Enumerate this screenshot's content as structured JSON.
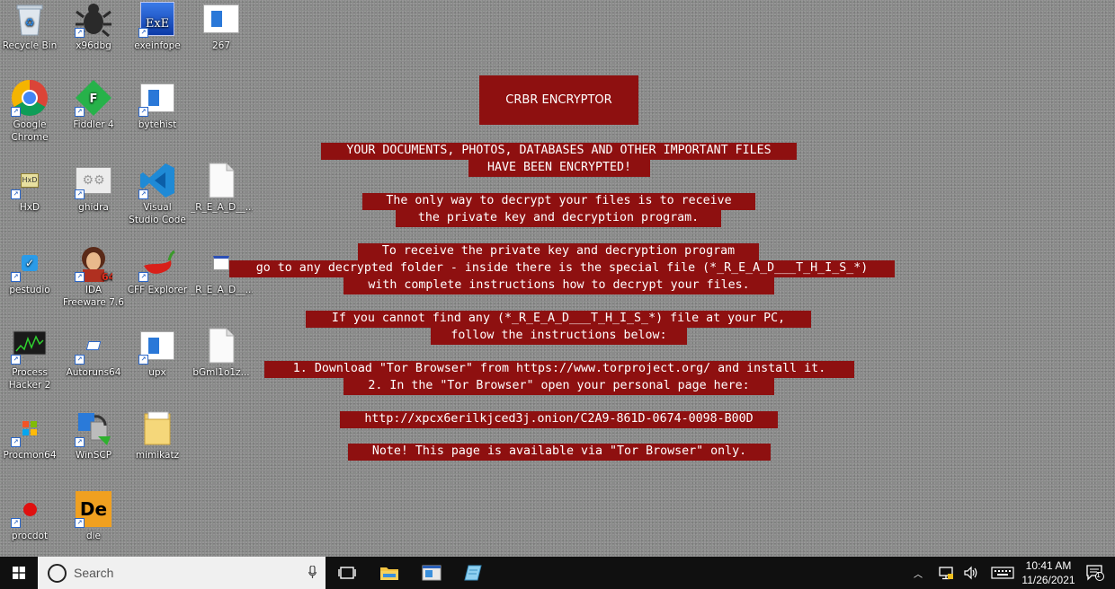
{
  "desktop": {
    "icons": [
      {
        "label": "Recycle Bin",
        "icon": "recycle-bin-icon"
      },
      {
        "label": "x96dbg",
        "icon": "bug-icon"
      },
      {
        "label": "exeinfope",
        "icon": "exe-icon"
      },
      {
        "label": "267",
        "icon": "window-file-icon"
      },
      {
        "label": "Google Chrome",
        "icon": "chrome-icon"
      },
      {
        "label": "Fiddler 4",
        "icon": "fiddler-icon"
      },
      {
        "label": "bytehist",
        "icon": "window-file-icon"
      },
      {
        "label": "HxD",
        "icon": "hex-editor-icon"
      },
      {
        "label": "ghidra",
        "icon": "ghidra-icon"
      },
      {
        "label": "Visual Studio Code",
        "icon": "vscode-icon"
      },
      {
        "label": "_R_E_A_D__...",
        "icon": "document-icon"
      },
      {
        "label": "pestudio",
        "icon": "pestudio-icon"
      },
      {
        "label": "IDA Freeware 7.6",
        "icon": "ida-icon"
      },
      {
        "label": "CFF Explorer",
        "icon": "pepper-icon"
      },
      {
        "label": "_R_E_A_D__...",
        "icon": "small-window-icon"
      },
      {
        "label": "Process Hacker 2",
        "icon": "process-hacker-icon"
      },
      {
        "label": "Autoruns64",
        "icon": "autoruns-icon"
      },
      {
        "label": "upx",
        "icon": "window-file-icon"
      },
      {
        "label": "bGml1o1z...",
        "icon": "document-icon"
      },
      {
        "label": "Procmon64",
        "icon": "procmon-icon"
      },
      {
        "label": "WinSCP",
        "icon": "winscp-icon"
      },
      {
        "label": "mimikatz",
        "icon": "folder-icon"
      },
      {
        "label": "procdot",
        "icon": "procdot-icon"
      },
      {
        "label": "die",
        "icon": "die-icon"
      }
    ]
  },
  "note": {
    "title": "CRBR ENCRYPTOR",
    "lines": [
      "YOUR DOCUMENTS, PHOTOS, DATABASES AND OTHER IMPORTANT FILES",
      "HAVE BEEN ENCRYPTED!",
      "The only way to decrypt your files is to receive",
      "the private key and decryption program.",
      "To receive the private key and decryption program",
      "go to any decrypted folder - inside there is the special file (*_R_E_A_D___T_H_I_S_*)",
      "with complete instructions how to decrypt your files.",
      "If you cannot find any (*_R_E_A_D___T_H_I_S_*) file at your PC,",
      "follow the instructions below:",
      "1. Download \"Tor Browser\" from https://www.torproject.org/ and install it.",
      "2. In the \"Tor Browser\" open your personal page here:",
      "http://xpcx6erilkjced3j.onion/C2A9-861D-0674-0098-B00D",
      "Note! This page is available via \"Tor Browser\" only."
    ],
    "color": "#8e1010"
  },
  "taskbar": {
    "search_placeholder": "Search",
    "time": "10:41 AM",
    "date": "11/26/2021",
    "notification_count": "1",
    "pinned": [
      "task-view-icon",
      "file-explorer-icon",
      "app-window-icon",
      "notepad-icon"
    ]
  }
}
